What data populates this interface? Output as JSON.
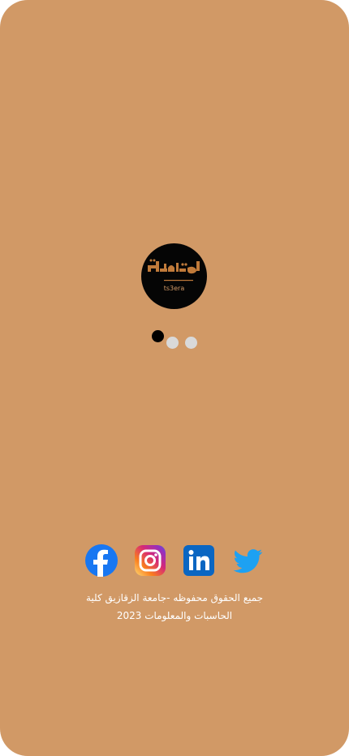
{
  "app": {
    "logo_wordmark": "تسعيرة",
    "logo_subtitle": "ts3era"
  },
  "pager": {
    "active_index": 0,
    "count": 3
  },
  "social": [
    {
      "name": "Facebook",
      "icon": "facebook-icon",
      "color": "#1877F2"
    },
    {
      "name": "Instagram",
      "icon": "instagram-icon",
      "color": "#E1306C"
    },
    {
      "name": "LinkedIn",
      "icon": "linkedin-icon",
      "color": "#0A66C2"
    },
    {
      "name": "Twitter",
      "icon": "twitter-icon",
      "color": "#1DA1F2"
    }
  ],
  "footer": {
    "line1": "جميع الحقوق محفوظه -جامعة الزقازيق كلية",
    "line2": "الحاسبات والمعلومات 2023"
  },
  "colors": {
    "background": "#D19966",
    "logo_circle": "#050505",
    "dot_active": "#000000",
    "dot_inactive": "#D9D9D9"
  }
}
